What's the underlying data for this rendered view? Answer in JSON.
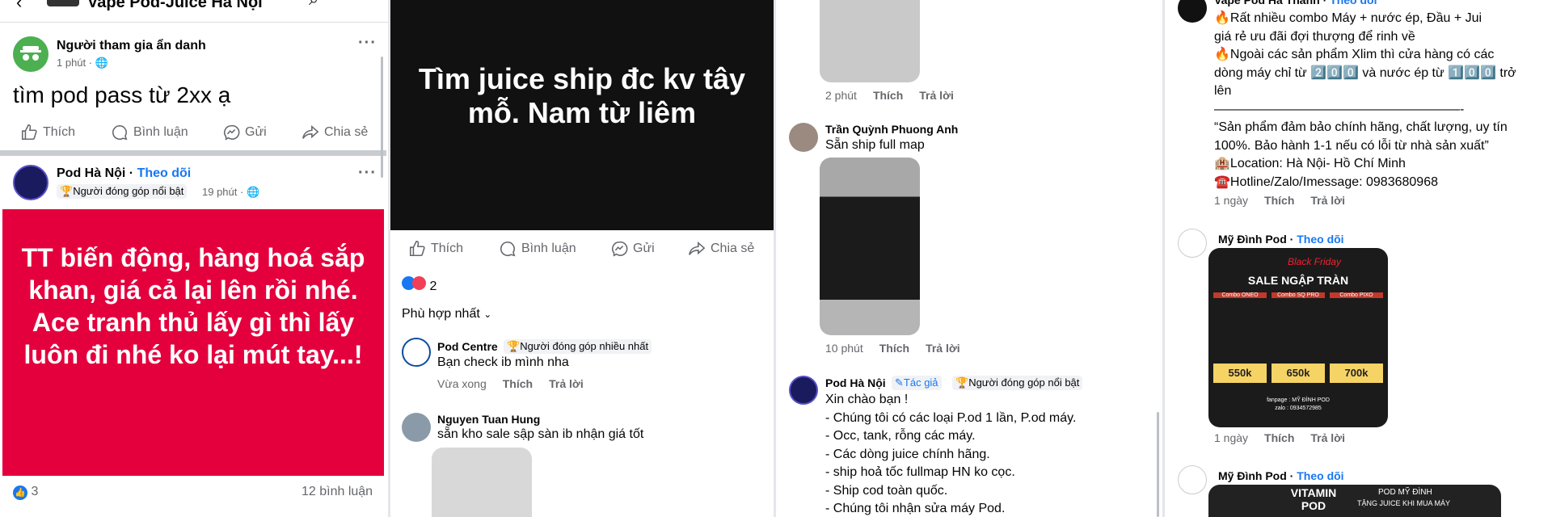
{
  "panel1": {
    "header_title": "Vape Pod-Juice Hà Nội",
    "post1": {
      "author": "Người tham gia ẩn danh",
      "time": "1 phút · ",
      "text": "tìm pod pass từ 2xx ạ",
      "like": "Thích",
      "comment": "Bình luận",
      "send": "Gửi",
      "share": "Chia sẻ"
    },
    "post2": {
      "author": "Pod Hà Nội",
      "follow": "Theo dõi",
      "badge": "Người đóng góp nổi bật",
      "time": "19 phút · ",
      "image_text": "TT biến động, hàng hoá sắp khan, giá cả lại lên rồi nhé. Ace tranh thủ lấy gì thì lấy luôn đi nhé ko lại mút tay...!",
      "reactions": "3",
      "comments_count": "12 bình luận"
    }
  },
  "panel2": {
    "image_text": "Tìm juice ship đc kv tây mỗ. Nam từ liêm",
    "like": "Thích",
    "comment": "Bình luận",
    "send": "Gửi",
    "share": "Chia sẻ",
    "reactions": "2",
    "sort": "Phù hợp nhất",
    "c1": {
      "name": "Pod Centre",
      "badge": "Người đóng góp nhiều nhất",
      "text": "Bạn check ib mình nha",
      "time": "Vừa xong",
      "like": "Thích",
      "reply": "Trả lời"
    },
    "c2": {
      "name": "Nguyen Tuan Hung",
      "text": "sẵn kho sale sập sàn ib nhận giá tốt"
    }
  },
  "panel3": {
    "c0": {
      "time": "2 phút",
      "like": "Thích",
      "reply": "Trả lời"
    },
    "c1": {
      "name": "Trần Quỳnh Phuong Anh",
      "text": "Sẵn ship full map",
      "time": "10 phút",
      "like": "Thích",
      "reply": "Trả lời"
    },
    "c2": {
      "name": "Pod Hà Nội",
      "author_badge": "Tác giả",
      "badge": "Người đóng góp nổi bật",
      "lines": [
        "Xin chào bạn !",
        "- Chúng tôi có các loại P.od 1 lần, P.od máy.",
        "- Occ, tank, rỗng các máy.",
        "- Các dòng juice chính hãng.",
        "- ship hoả tốc fullmap HN ko cọc.",
        "- Ship cod toàn quốc.",
        "- Chúng tôi nhận sửa máy Pod."
      ]
    }
  },
  "panel4": {
    "c0": {
      "name": "Vape Pod Hà Thành",
      "follow": "Theo dõi",
      "lines": [
        "🔥Rất nhiều combo Máy + nước ép,  Đầu + Jui",
        "giá rẻ ưu đãi  đợi thượng để rinh về",
        "🔥Ngoài các sản phẩm Xlim thì cửa hàng có các",
        "dòng máy chỉ từ 2️⃣0️⃣0️⃣ và nước ép từ 1️⃣0️⃣0️⃣ trở",
        "lên",
        "———————————————————-",
        "“Sản phẩm đảm bảo chính hãng, chất lượng, uy tín",
        "100%. Bảo hành 1-1 nếu có lỗi từ nhà sản xuất”",
        "🏨Location: Hà Nội- Hồ Chí Minh",
        "☎️Hotline/Zalo/Imessage: 0983680968"
      ],
      "time": "1 ngày",
      "like": "Thích",
      "reply": "Trả lời"
    },
    "c1": {
      "name": "Mỹ Đình Pod",
      "follow": "Theo dõi",
      "banner": {
        "title": "SALE NGẬP TRÀN",
        "black_friday": "Black Friday",
        "combos": [
          "Combo ONEO",
          "Combo SQ PRO",
          "Combo PIXO"
        ],
        "prices": [
          "550k",
          "650k",
          "700k"
        ],
        "fanpage": "fanpage : MỸ ĐÌNH POD",
        "zalo": "zalo : 0934572985"
      },
      "time": "1 ngày",
      "like": "Thích",
      "reply": "Trả lời"
    },
    "c2": {
      "name": "Mỹ Đình Pod",
      "follow": "Theo dõi",
      "banner_title": "VITAMIN POD",
      "banner_sub": "POD MỸ ĐÌNH",
      "banner_sub2": "TẶNG JUICE KHI MUA MÁY"
    }
  },
  "colors": {
    "accent": "#1877f2",
    "red_card": "#e4003d",
    "meta": "#65676b"
  }
}
